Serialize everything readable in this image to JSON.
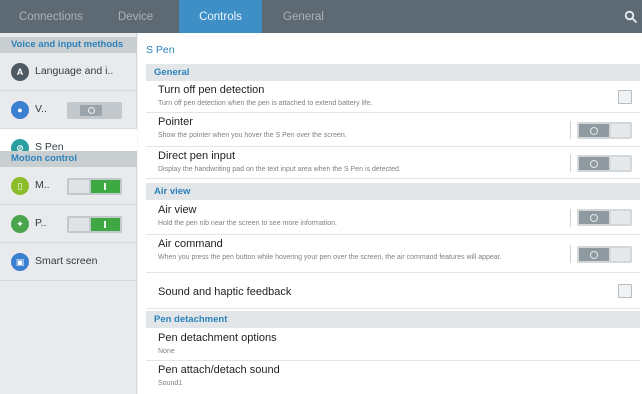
{
  "tabs": [
    {
      "label": "Connections"
    },
    {
      "label": "Device"
    },
    {
      "label": "Controls"
    },
    {
      "label": "General"
    }
  ],
  "sidebar": {
    "categories": [
      {
        "label": "Voice and input methods"
      },
      {
        "label": "Motion control"
      }
    ],
    "items": [
      {
        "label": "Language and i..",
        "icon": "keyboard-icon",
        "icon_glyph": "A",
        "color": "#4d5a63"
      },
      {
        "label": "V..",
        "icon": "microphone-icon",
        "icon_glyph": "●",
        "color": "#3a7fd0",
        "toggle": "off"
      },
      {
        "label": "S Pen",
        "icon": "s-pen-icon",
        "icon_glyph": "⊘",
        "color": "#2b9ea0"
      },
      {
        "label": "M..",
        "icon": "motion-icon",
        "icon_glyph": "▯",
        "color": "#8bbd2a",
        "toggle": "on"
      },
      {
        "label": "P..",
        "icon": "palm-motion-icon",
        "icon_glyph": "✦",
        "color": "#4aa54c",
        "toggle": "on"
      },
      {
        "label": "Smart screen",
        "icon": "smart-screen-icon",
        "icon_glyph": "▣",
        "color": "#3a7fd0"
      }
    ]
  },
  "main": {
    "title": "S Pen",
    "sections": [
      {
        "label": "General"
      },
      {
        "label": "Air view"
      },
      {
        "label": "Pen detachment"
      }
    ],
    "rows": [
      {
        "title": "Turn off pen detection",
        "subtitle": "Turn off pen detection when the pen is attached to extend battery life.",
        "control": "checkbox",
        "checked": false
      },
      {
        "title": "Pointer",
        "subtitle": "Show the pointer when you hover the S Pen over the screen.",
        "control": "toggle",
        "on": false
      },
      {
        "title": "Direct pen input",
        "subtitle": "Display the handwriting pad on the text input area when the S Pen is detected.",
        "control": "toggle",
        "on": false
      },
      {
        "title": "Air view",
        "subtitle": "Hold the pen nib near the screen to see more information.",
        "control": "toggle",
        "on": false
      },
      {
        "title": "Air command",
        "subtitle": "When you press the pen button while hovering your pen over the screen, the air command features will appear.",
        "control": "toggle",
        "on": false
      },
      {
        "title": "Sound and haptic feedback",
        "subtitle": "",
        "control": "checkbox",
        "checked": false
      },
      {
        "title": "Pen detachment options",
        "subtitle": "None",
        "control": "none"
      },
      {
        "title": "Pen attach/detach sound",
        "subtitle": "Sound1",
        "control": "none"
      }
    ]
  },
  "colors": {
    "accent": "#3e8fc6",
    "topbar": "#5d6a74",
    "toggle_on": "#3ea843"
  }
}
